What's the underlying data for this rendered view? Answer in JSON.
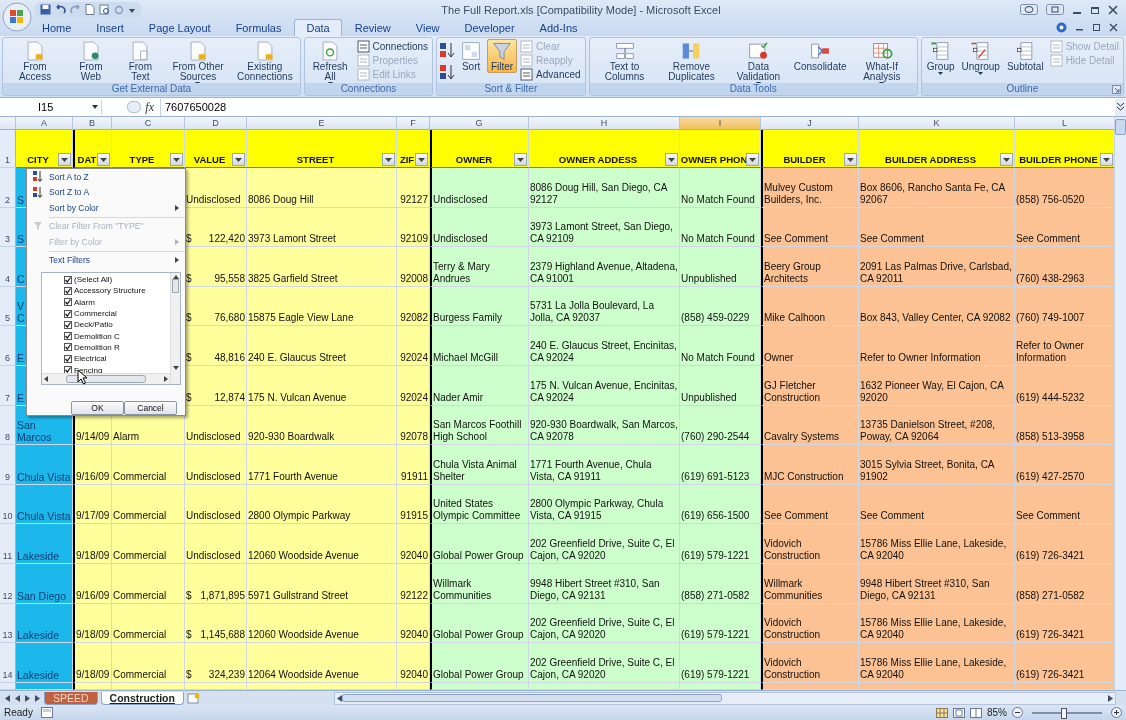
{
  "window": {
    "title": "The Full Report.xls  [Compatibility Mode] - Microsoft Excel"
  },
  "ribbon_tabs": [
    {
      "label": "Home",
      "selected": false
    },
    {
      "label": "Insert",
      "selected": false
    },
    {
      "label": "Page Layout",
      "selected": false
    },
    {
      "label": "Formulas",
      "selected": false
    },
    {
      "label": "Data",
      "selected": true
    },
    {
      "label": "Review",
      "selected": false
    },
    {
      "label": "View",
      "selected": false
    },
    {
      "label": "Developer",
      "selected": false
    },
    {
      "label": "Add-Ins",
      "selected": false
    }
  ],
  "ribbon_groups": [
    {
      "label": "Get External Data",
      "buttons": [
        {
          "kind": "large",
          "label": "From Access",
          "disabled": false
        },
        {
          "kind": "large",
          "label": "From Web",
          "disabled": false
        },
        {
          "kind": "large",
          "label": "From Text",
          "disabled": false
        },
        {
          "kind": "large",
          "label": "From Other Sources",
          "dropdown": true,
          "disabled": false
        },
        {
          "kind": "large",
          "label": "Existing Connections",
          "disabled": false
        }
      ]
    },
    {
      "label": "Connections",
      "buttons": [
        {
          "kind": "large",
          "label": "Refresh All",
          "dropdown": true,
          "disabled": false
        },
        {
          "kind": "small",
          "label": "Connections",
          "disabled": false
        },
        {
          "kind": "small",
          "label": "Properties",
          "disabled": true
        },
        {
          "kind": "small",
          "label": "Edit Links",
          "disabled": true
        }
      ]
    },
    {
      "label": "Sort & Filter",
      "buttons": [
        {
          "kind": "sortpair",
          "disabled": false
        },
        {
          "kind": "large",
          "label": "Sort",
          "disabled": false
        },
        {
          "kind": "large",
          "label": "Filter",
          "active": true,
          "disabled": false
        },
        {
          "kind": "small",
          "label": "Clear",
          "disabled": true
        },
        {
          "kind": "small",
          "label": "Reapply",
          "disabled": true
        },
        {
          "kind": "small",
          "label": "Advanced",
          "disabled": false
        }
      ]
    },
    {
      "label": "Data Tools",
      "buttons": [
        {
          "kind": "large",
          "label": "Text to Columns",
          "disabled": false
        },
        {
          "kind": "large",
          "label": "Remove Duplicates",
          "disabled": false
        },
        {
          "kind": "large",
          "label": "Data Validation",
          "dropdown": true,
          "disabled": false
        },
        {
          "kind": "large",
          "label": "Consolidate",
          "disabled": false
        },
        {
          "kind": "large",
          "label": "What-If Analysis",
          "dropdown": true,
          "disabled": false
        }
      ]
    },
    {
      "label": "Outline",
      "launcher": true,
      "buttons": [
        {
          "kind": "large",
          "label": "Group",
          "dropdown": true,
          "disabled": false
        },
        {
          "kind": "large",
          "label": "Ungroup",
          "dropdown": true,
          "disabled": false
        },
        {
          "kind": "large",
          "label": "Subtotal",
          "disabled": false
        },
        {
          "kind": "small",
          "label": "Show Detail",
          "disabled": true
        },
        {
          "kind": "small",
          "label": "Hide Detail",
          "disabled": true
        }
      ]
    }
  ],
  "formula_bar": {
    "name_box": "I15",
    "fx_label": "fx",
    "formula": "7607650028"
  },
  "columns": [
    {
      "letter": "A",
      "heading": "CITY",
      "color": "#1cb8ec",
      "selected": false
    },
    {
      "letter": "B",
      "heading": "DAT",
      "color": "#ffff9c",
      "selected": false
    },
    {
      "letter": "C",
      "heading": "TYPE",
      "color": "#ffff9c",
      "selected": false
    },
    {
      "letter": "D",
      "heading": "VALUE",
      "color": "#ffff9c",
      "selected": false
    },
    {
      "letter": "E",
      "heading": "STREET",
      "color": "#ffff9c",
      "selected": false
    },
    {
      "letter": "F",
      "heading": "ZIF",
      "color": "#ffff9c",
      "selected": false
    },
    {
      "letter": "G",
      "heading": "OWNER",
      "color": "#ccffcc",
      "selected": false
    },
    {
      "letter": "H",
      "heading": "OWNER ADDESS",
      "color": "#ccffcc",
      "selected": false
    },
    {
      "letter": "I",
      "heading": "OWNER PHON",
      "color": "#ccffcc",
      "selected": true
    },
    {
      "letter": "J",
      "heading": "BUILDER",
      "color": "#fcc294",
      "selected": false
    },
    {
      "letter": "K",
      "heading": "BUILDER ADDRESS",
      "color": "#fcc294",
      "selected": false
    },
    {
      "letter": "L",
      "heading": "BUILDER PHONE",
      "color": "#fcc294",
      "selected": false
    }
  ],
  "header_row_number": "1",
  "rows": [
    {
      "number": "2",
      "cells": [
        "S",
        null,
        null,
        "Undisclosed",
        "8086 Doug Hill",
        "92127",
        "Undisclosed",
        "8086 Doug Hill, San Diego, CA 92127",
        "No Match Found",
        "Mulvey Custom Builders, Inc.",
        "Box 8606, Rancho Santa Fe, CA 92067",
        "(858) 756-0520"
      ]
    },
    {
      "number": "3",
      "cells": [
        "S",
        null,
        null,
        {
          "currency": "$",
          "amount": "122,420"
        },
        "3973 Lamont Street",
        "92109",
        "Undisclosed",
        "3973 Lamont Street, San Diego, CA 92109",
        "No Match Found",
        "See Comment",
        "See Comment",
        "See Comment"
      ]
    },
    {
      "number": "4",
      "cells": [
        "C",
        null,
        null,
        {
          "currency": "$",
          "amount": "95,558"
        },
        "3825 Garfield Street",
        "92008",
        "Terry & Mary Andrues",
        "2379 Highland Avenue, Altadena, CA 91001",
        "Unpublished",
        "Beery Group Architects",
        "2091 Las Palmas Drive, Carlsbad, CA 92011",
        "(760) 438-2963"
      ]
    },
    {
      "number": "5",
      "cells": [
        "V C",
        null,
        null,
        {
          "currency": "$",
          "amount": "76,680"
        },
        "15875 Eagle View Lane",
        "92082",
        "Burgess Family",
        "5731 La Jolla Boulevard, La Jolla, CA 92037",
        "(858) 459-0229",
        "Mike Calhoon",
        "Box 843, Valley Center, CA 92082",
        "(760) 749-1007"
      ]
    },
    {
      "number": "6",
      "cells": [
        "E",
        null,
        null,
        {
          "currency": "$",
          "amount": "48,816"
        },
        "240 E. Glaucus Street",
        "92024",
        "Michael McGill",
        "240 E. Glaucus Street, Encinitas, CA 92024",
        "No Match Found",
        "Owner",
        "Refer to Owner Information",
        "Refer to Owner Information"
      ]
    },
    {
      "number": "7",
      "cells": [
        "E",
        null,
        null,
        {
          "currency": "$",
          "amount": "12,874"
        },
        "175 N. Vulcan Avenue",
        "92024",
        "Nader Amir",
        "175 N. Vulcan Avenue, Encinitas, CA 92024",
        "Unpublished",
        "GJ Fletcher Construction",
        "1632 Pioneer Way, El Cajon, CA 92020",
        "(619) 444-5232"
      ]
    },
    {
      "number": "8",
      "cells": [
        "San Marcos",
        "9/14/09",
        "Alarm",
        "Undisclosed",
        "920-930 Boardwalk",
        "92078",
        "San Marcos Foothill High School",
        "920-930 Boardwalk, San Marcos, CA 92078",
        "(760) 290-2544",
        "Cavalry Systems",
        "13735 Danielson Street, #208, Poway, CA 92064",
        "(858) 513-3958"
      ]
    },
    {
      "number": "9",
      "cells": [
        "Chula Vista",
        "9/16/09",
        "Commercial",
        "Undisclosed",
        "1771 Fourth Avenue",
        "91911",
        "Chula Vista Animal Shelter",
        "1771 Fourth Avenue, Chula Vista, CA 91911",
        "(619) 691-5123",
        "MJC Construction",
        "3015 Sylvia Street, Bonita, CA 91902",
        "(619) 427-2570"
      ]
    },
    {
      "number": "10",
      "cells": [
        "Chula Vista",
        "9/17/09",
        "Commercial",
        "Undisclosed",
        "2800 Olympic Parkway",
        "91915",
        "United States Olympic Committee",
        "2800 Olympic Parkway, Chula Vista, CA 91915",
        "(619) 656-1500",
        "See Comment",
        "See Comment",
        "See Comment"
      ]
    },
    {
      "number": "11",
      "cells": [
        "Lakeside",
        "9/18/09",
        "Commercial",
        "Undisclosed",
        "12060 Woodside Avenue",
        "92040",
        "Global Power Group",
        "202 Greenfield Drive, Suite C, El Cajon, CA 92020",
        "(619) 579-1221",
        "Vidovich Construction",
        "15786 Miss Ellie Lane, Lakeside, CA 92040",
        "(619) 726-3421"
      ]
    },
    {
      "number": "12",
      "cells": [
        "San Diego",
        "9/16/09",
        "Commercial",
        {
          "currency": "$",
          "amount": "1,871,895"
        },
        "5971 Gullstrand Street",
        "92122",
        "Willmark Communities",
        "9948 Hibert Street #310, San Diego, CA 92131",
        "(858) 271-0582",
        "Willmark Communities",
        "9948 Hibert Street #310, San Diego, CA 92131",
        "(858) 271-0582"
      ]
    },
    {
      "number": "13",
      "cells": [
        "Lakeside",
        "9/18/09",
        "Commercial",
        {
          "currency": "$",
          "amount": "1,145,688"
        },
        "12060 Woodside Avenue",
        "92040",
        "Global Power Group",
        "202 Greenfield Drive, Suite C, El Cajon, CA 92020",
        "(619) 579-1221",
        "Vidovich Construction",
        "15786 Miss Ellie Lane, Lakeside, CA 92040",
        "(619) 726-3421"
      ]
    },
    {
      "number": "14",
      "cells": [
        "Lakeside",
        "9/18/09",
        "Commercial",
        {
          "currency": "$",
          "amount": "324,239"
        },
        "12064 Woodside Avenue",
        "92040",
        "Global Power Group",
        "202 Greenfield Drive, Suite C, El Cajon, CA 92020",
        "(619) 579-1221",
        "Vidovich Construction",
        "15786 Miss Ellie Lane, Lakeside, CA 92040",
        "(619) 726-3421"
      ]
    }
  ],
  "filter_menu": {
    "items": [
      {
        "label": "Sort A to Z",
        "disabled": false,
        "submenu": false
      },
      {
        "label": "Sort Z to A",
        "disabled": false,
        "submenu": false
      },
      {
        "label": "Sort by Color",
        "disabled": false,
        "submenu": true
      },
      {
        "label": "Clear Filter From \"TYPE\"",
        "disabled": true,
        "submenu": false
      },
      {
        "label": "Filter by Color",
        "disabled": true,
        "submenu": true
      },
      {
        "label": "Text Filters",
        "disabled": false,
        "submenu": true
      }
    ],
    "list": [
      {
        "label": "(Select All)",
        "checked": true
      },
      {
        "label": "Accessory Structure",
        "checked": true
      },
      {
        "label": "Alarm",
        "checked": true
      },
      {
        "label": "Commercial",
        "checked": true
      },
      {
        "label": "Deck/Patio",
        "checked": true
      },
      {
        "label": "Demolition C",
        "checked": true
      },
      {
        "label": "Demolition R",
        "checked": true
      },
      {
        "label": "Electrical",
        "checked": true
      },
      {
        "label": "Fencing",
        "checked": true
      }
    ],
    "buttons": [
      "OK",
      "Cancel"
    ]
  },
  "sheet_tabs": [
    {
      "label": "SPEED",
      "color": "#c0603c",
      "selected": false
    },
    {
      "label": "Construction",
      "selected": true
    }
  ],
  "status_bar": {
    "status": "Ready",
    "zoom": {
      "label": "85%",
      "level": 0.45
    }
  }
}
